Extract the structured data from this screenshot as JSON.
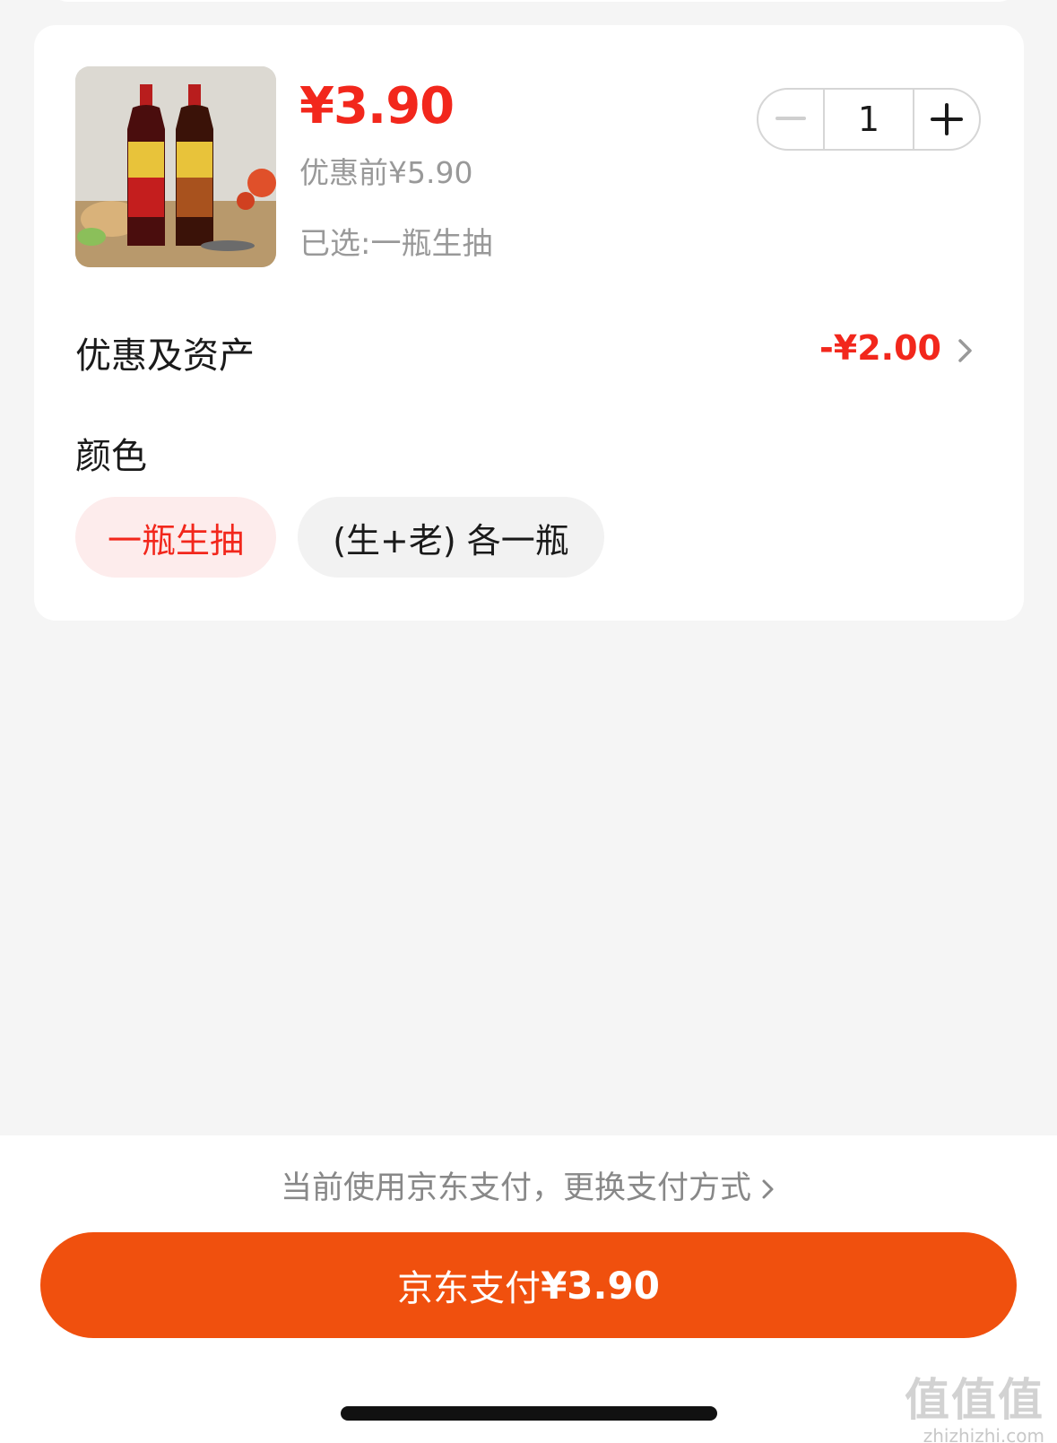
{
  "product": {
    "price": "¥3.90",
    "original_price": "优惠前¥5.90",
    "selected": "已选:一瓶生抽",
    "quantity": "1"
  },
  "discount_row": {
    "title": "优惠及资产",
    "value": "-¥2.00"
  },
  "options": {
    "title": "颜色",
    "items": [
      {
        "label": "一瓶生抽",
        "selected": true
      },
      {
        "label": "(生+老) 各一瓶",
        "selected": false
      }
    ]
  },
  "payment": {
    "tip": "当前使用京东支付，更换支付方式",
    "button_label": "京东支付",
    "button_amount": "¥3.90"
  },
  "watermark": {
    "big": "值值值",
    "small": "zhizhizhi.com"
  },
  "colors": {
    "accent_red": "#f2271c",
    "pay_orange": "#f0500e"
  }
}
